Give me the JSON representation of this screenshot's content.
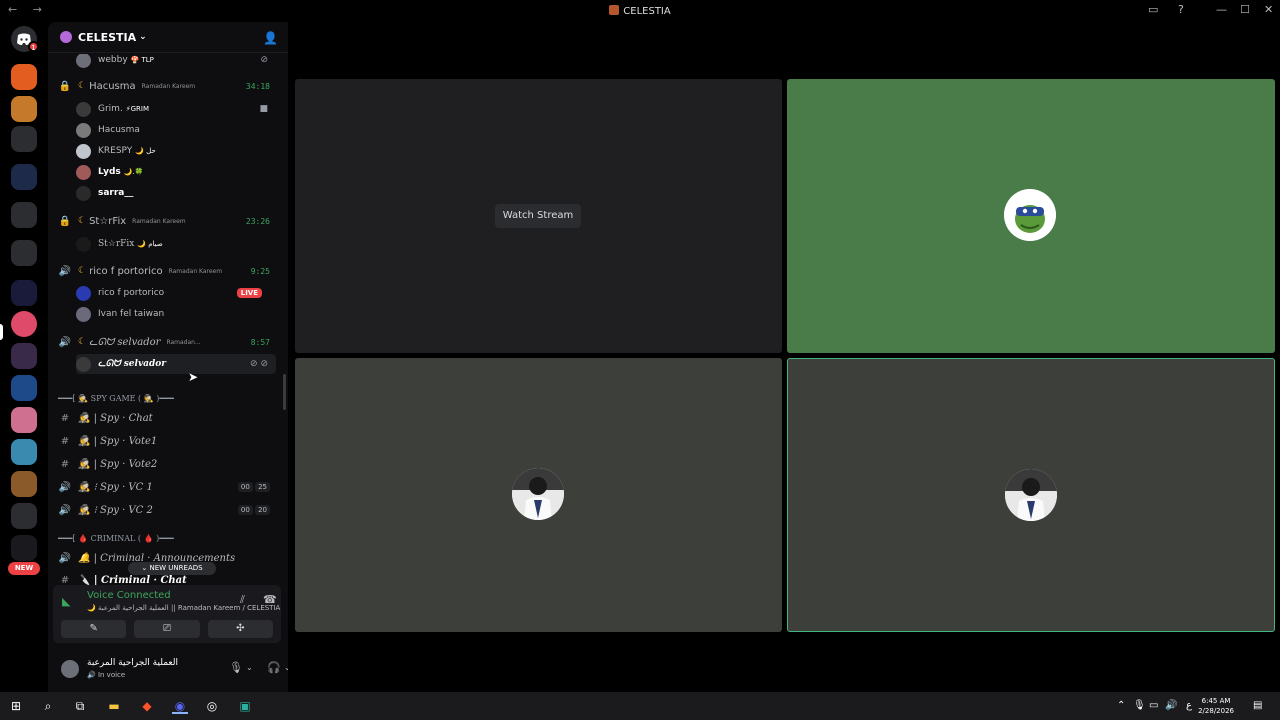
{
  "window": {
    "title": "CELESTIA",
    "nav": "← →"
  },
  "server": {
    "name": "CELESTIA",
    "badge_count": "1",
    "new_label": "NEW"
  },
  "voice_channels": [
    {
      "name": "Hacusma",
      "tag": "Ramadan Kareem",
      "timer": "34:18"
    },
    {
      "name": "St☆rFix",
      "tag": "Ramadan Kareem",
      "timer": "23:26"
    },
    {
      "name": "rico f portorico",
      "tag": "Ramadan Kareem",
      "timer": "9:25"
    },
    {
      "name": "ᓚᘏᗢ selvador",
      "tag": "Ramadan...",
      "timer": "8:57"
    }
  ],
  "users": {
    "webby": "webby",
    "webby_tag": "🍄 TLP",
    "grim": "Grim.",
    "grim_tag": "⚡GRIM",
    "hacusma": "Hacusma",
    "krespy": "KRESPY",
    "krespy_tag": "🌙 حل",
    "lyds": "Lyds",
    "lyds_tag": "🌙.🍀",
    "sarra": "sarra__",
    "starfix": "St☆rFix",
    "starfix_tag": "🌙 صيام",
    "rico": "rico f portorico",
    "ivan": "Ivan fel taiwan",
    "selvador": "ᓚᘏᗢ selvador",
    "live": "LIVE"
  },
  "categories": {
    "spy": "━━━[ 🕵 SPY GAME ( 🕵 )━━━",
    "criminal": "━━━[ 🩸 CRIMINAL ( 🩸 )━━━"
  },
  "text_channels": [
    {
      "icon": "#",
      "name": "🕵 | Spy · Chat"
    },
    {
      "icon": "#",
      "name": "🕵 | Spy · Vote1"
    },
    {
      "icon": "#",
      "name": "🕵 | Spy · Vote2"
    },
    {
      "icon": "🔊",
      "name": "🕵 ⁝ Spy · VC 1",
      "a": "00",
      "b": "25"
    },
    {
      "icon": "🔊",
      "name": "🕵 ⁝ Spy · VC 2",
      "a": "00",
      "b": "20"
    },
    {
      "icon": "🔊",
      "name": "🔔 | Criminal · Announcements"
    },
    {
      "icon": "#",
      "name": "🔪 | Criminal · Chat"
    }
  ],
  "new_unreads": "NEW UNREADS",
  "voice_panel": {
    "title": "Voice Connected",
    "subtitle": "🌙 العملية الجراحية المرعبة || Ramadan Kareem / CELESTIA"
  },
  "user_panel": {
    "name": "العملية الجراحية المرعبة",
    "status": "In voice"
  },
  "stage": {
    "watch_label": "Watch Stream"
  },
  "taskbar": {
    "time": "6:45 AM",
    "date": "2/28/2026",
    "lang": "ع"
  },
  "colors": {
    "accent_green": "#3ba55d",
    "live_red": "#ed4245",
    "tile_green": "#4a7c4a",
    "speaking_border": "#43b581"
  }
}
